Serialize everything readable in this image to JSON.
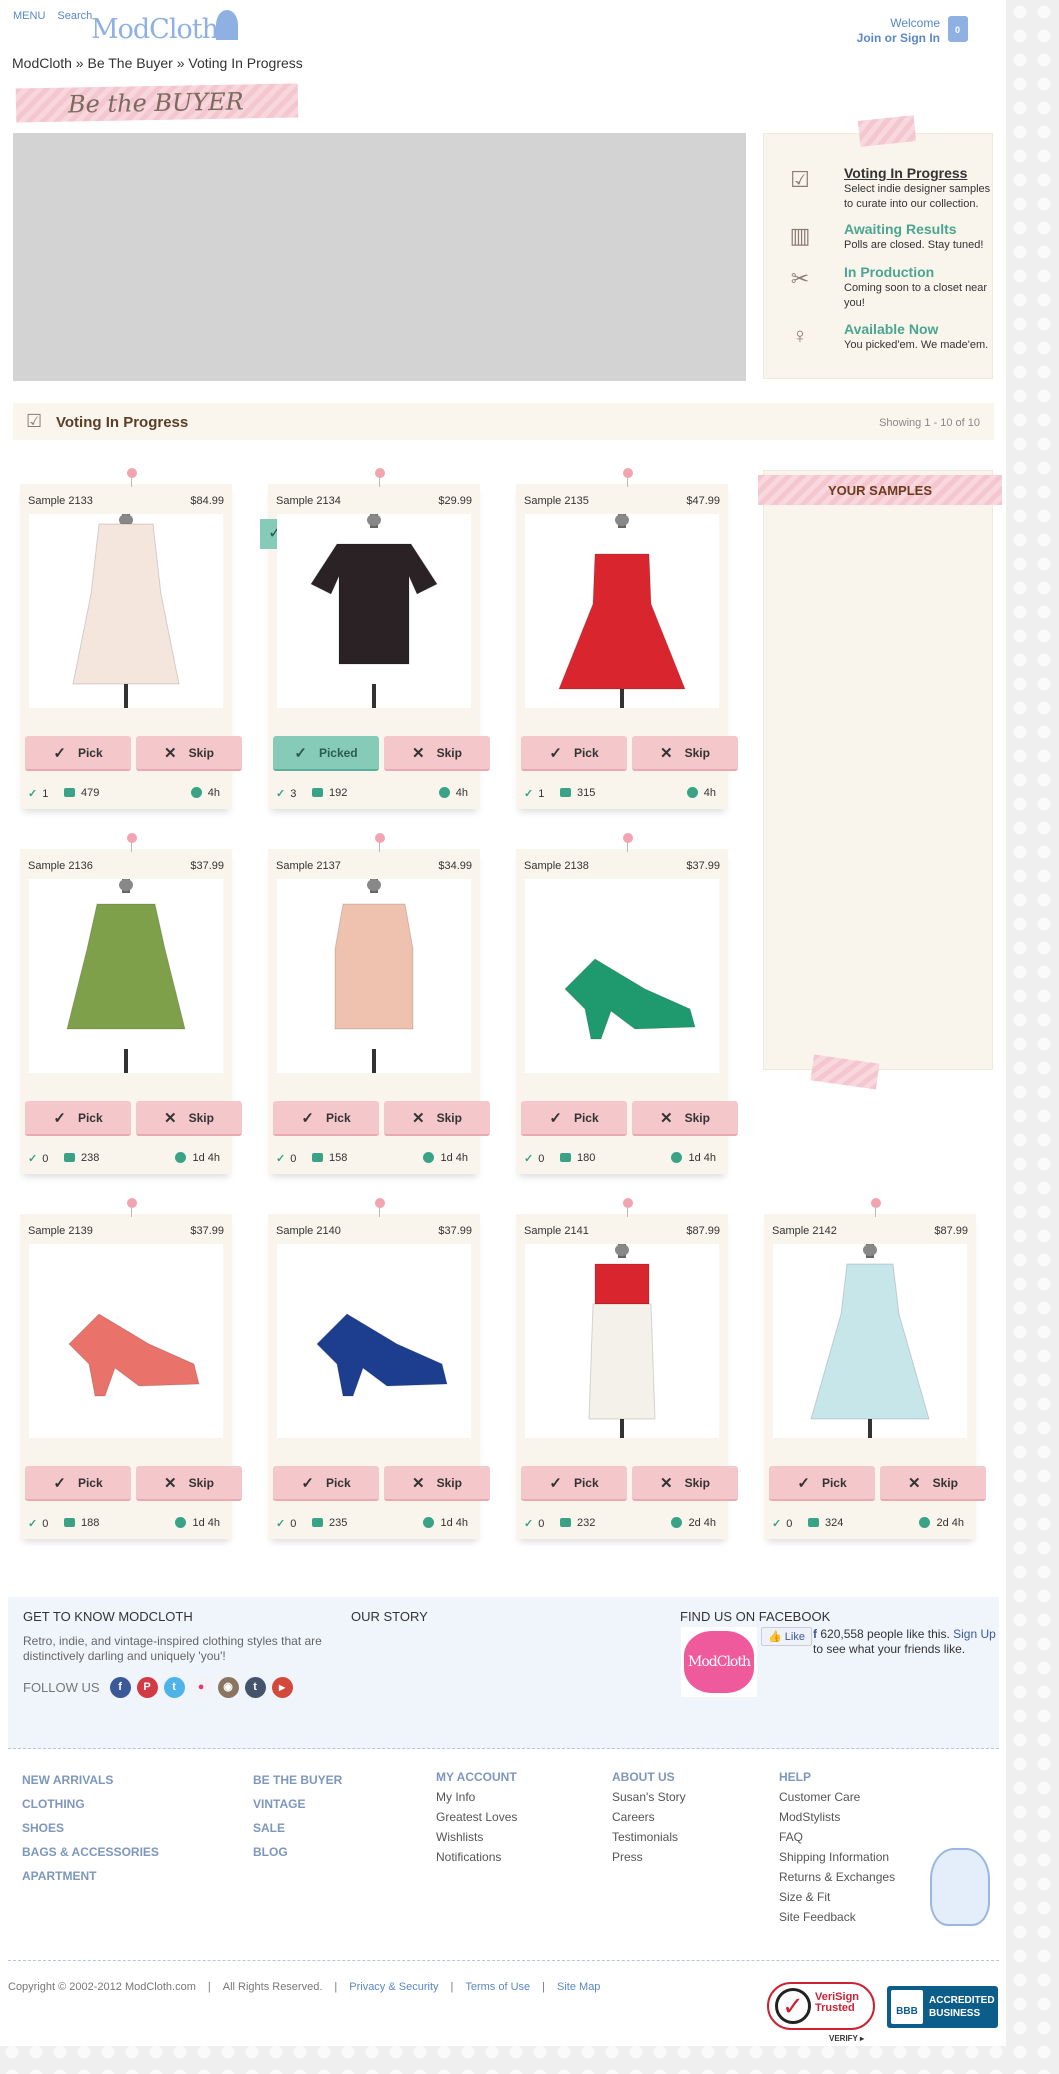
{
  "header": {
    "menu": "MENU",
    "search": "Search",
    "logo": "ModCloth",
    "welcome": "Welcome",
    "join": "Join or Sign In",
    "bag_count": "0"
  },
  "breadcrumb": "ModCloth » Be The Buyer » Voting In Progress",
  "banner": {
    "text": "Be the BUYER"
  },
  "status_list": [
    {
      "title": "Voting In Progress",
      "desc": "Select indie designer samples to curate into our collection.",
      "icon": "ballot-box-icon"
    },
    {
      "title": "Awaiting Results",
      "desc": "Polls are closed. Stay tuned!",
      "icon": "bar-chart-icon"
    },
    {
      "title": "In Production",
      "desc": "Coming soon to a closet near you!",
      "icon": "sewing-machine-icon"
    },
    {
      "title": "Available Now",
      "desc": "You picked'em. We made'em.",
      "icon": "dress-form-icon"
    }
  ],
  "voting_bar": {
    "title": "Voting In Progress",
    "showing": "Showing 1 - 10 of 10"
  },
  "your_samples": "YOUR SAMPLES",
  "buttons": {
    "pick": "Pick",
    "picked": "Picked",
    "skip": "Skip"
  },
  "samples": [
    {
      "name": "Sample 2133",
      "price": "$84.99",
      "votes": "1",
      "comments": "479",
      "time": "4h",
      "picked": false,
      "product": "cream-lace-dress",
      "color": "#f4e6dc"
    },
    {
      "name": "Sample 2134",
      "price": "$29.99",
      "votes": "3",
      "comments": "192",
      "time": "4h",
      "picked": true,
      "product": "black-top",
      "color": "#2a2224"
    },
    {
      "name": "Sample 2135",
      "price": "$47.99",
      "votes": "1",
      "comments": "315",
      "time": "4h",
      "picked": false,
      "product": "red-dress",
      "color": "#d9262e"
    },
    {
      "name": "Sample 2136",
      "price": "$37.99",
      "votes": "0",
      "comments": "238",
      "time": "1d 4h",
      "picked": false,
      "product": "green-top",
      "color": "#7fa04a"
    },
    {
      "name": "Sample 2137",
      "price": "$34.99",
      "votes": "0",
      "comments": "158",
      "time": "1d 4h",
      "picked": false,
      "product": "polka-dot-top",
      "color": "#efc2b0"
    },
    {
      "name": "Sample 2138",
      "price": "$37.99",
      "votes": "0",
      "comments": "180",
      "time": "1d 4h",
      "picked": false,
      "product": "green-shoe",
      "color": "#1f9a6e"
    },
    {
      "name": "Sample 2139",
      "price": "$37.99",
      "votes": "0",
      "comments": "188",
      "time": "1d 4h",
      "picked": false,
      "product": "coral-shoe",
      "color": "#e9736b"
    },
    {
      "name": "Sample 2140",
      "price": "$37.99",
      "votes": "0",
      "comments": "235",
      "time": "1d 4h",
      "picked": false,
      "product": "blue-shoe",
      "color": "#1d3d8f"
    },
    {
      "name": "Sample 2141",
      "price": "$87.99",
      "votes": "0",
      "comments": "232",
      "time": "2d 4h",
      "picked": false,
      "product": "red-white-dress",
      "color": "#d9262e"
    },
    {
      "name": "Sample 2142",
      "price": "$87.99",
      "votes": "0",
      "comments": "324",
      "time": "2d 4h",
      "picked": false,
      "product": "mint-dress",
      "color": "#c6e6ea"
    }
  ],
  "footer": {
    "get_to_know": "GET TO KNOW MODCLOTH",
    "about_text": "Retro, indie, and vintage-inspired clothing styles that are distinctively darling and uniquely 'you'!",
    "follow": "FOLLOW US",
    "our_story": "OUR STORY",
    "find_fb": "FIND US ON FACEBOOK",
    "fb_logo": "ModCloth",
    "like": "Like",
    "fb_count": "620,558 people like this.",
    "fb_signup": "Sign Up",
    "fb_tail": "to see what your friends like.",
    "col1": [
      "NEW ARRIVALS",
      "CLOTHING",
      "SHOES",
      "BAGS & ACCESSORIES",
      "APARTMENT"
    ],
    "col2": [
      "BE THE BUYER",
      "VINTAGE",
      "SALE",
      "BLOG"
    ],
    "my_account": {
      "head": "MY ACCOUNT",
      "links": [
        "My Info",
        "Greatest Loves",
        "Wishlists",
        "Notifications"
      ]
    },
    "about_us": {
      "head": "ABOUT US",
      "links": [
        "Susan's Story",
        "Careers",
        "Testimonials",
        "Press"
      ]
    },
    "help": {
      "head": "HELP",
      "links": [
        "Customer Care",
        "ModStylists",
        "FAQ",
        "Shipping Information",
        "Returns & Exchanges",
        "Size & Fit",
        "Site Feedback"
      ]
    },
    "copyright": "Copyright © 2002-2012 ModCloth.com",
    "rights": "All Rights Reserved.",
    "privacy": "Privacy & Security",
    "terms": "Terms of Use",
    "sitemap": "Site Map",
    "verisign": "VeriSign Trusted",
    "verify": "VERIFY ▸",
    "bbb": "ACCREDITED BUSINESS",
    "bbb_logo": "BBB"
  }
}
